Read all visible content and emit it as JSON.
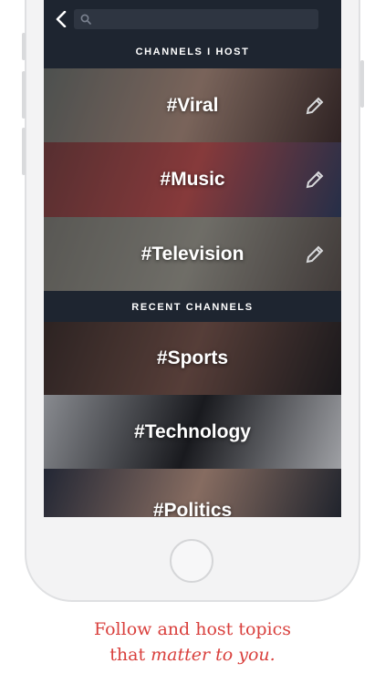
{
  "search": {
    "placeholder": ""
  },
  "sections": {
    "hosted_title": "CHANNELS I HOST",
    "recent_title": "RECENT CHANNELS"
  },
  "hosted_channels": [
    {
      "label": "#Viral",
      "colors": [
        "#6b6f68",
        "#b08d7a",
        "#3e2a26"
      ]
    },
    {
      "label": "#Music",
      "colors": [
        "#7a3c3a",
        "#c44d4a",
        "#2f3c5e"
      ]
    },
    {
      "label": "#Television",
      "colors": [
        "#7d7a70",
        "#a09c8e",
        "#5a4f48"
      ]
    }
  ],
  "recent_channels": [
    {
      "label": "#Sports",
      "colors": [
        "#3a2a24",
        "#7a5346",
        "#1e1a1a"
      ]
    },
    {
      "label": "#Technology",
      "colors": [
        "#c7c9cc",
        "#1c1c1e",
        "#e9eaec"
      ]
    },
    {
      "label": "#Politics",
      "colors": [
        "#2b3040",
        "#c49a84",
        "#1e2530"
      ]
    }
  ],
  "caption": {
    "line1": "Follow and host topics",
    "line2_plain": "that ",
    "line2_italic": "matter to you."
  },
  "accent_color": "#d9403d"
}
